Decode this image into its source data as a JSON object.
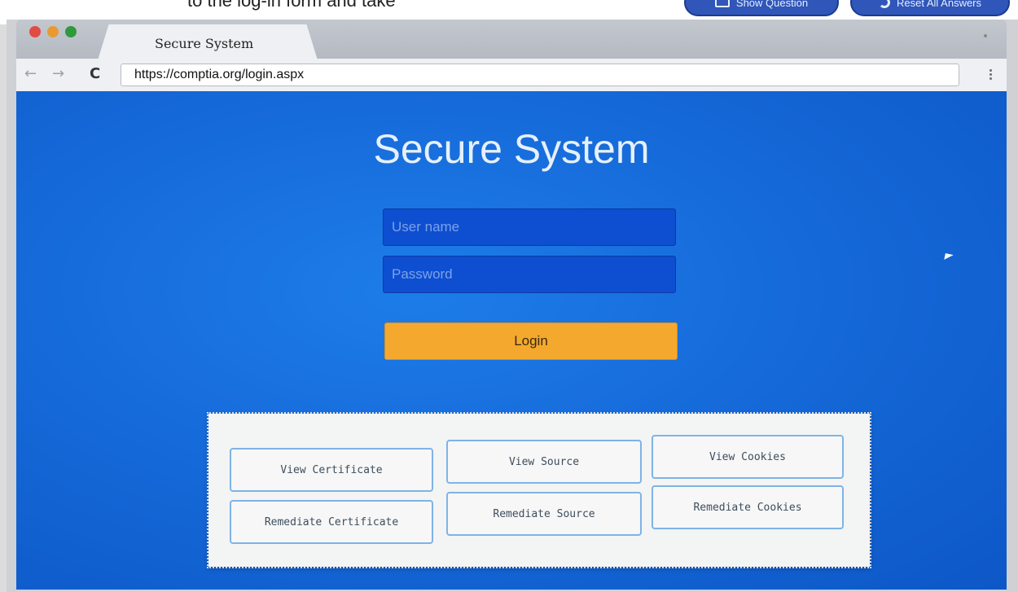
{
  "outer": {
    "clipped_text": "to the log-in form and take",
    "show_question_label": "Show Question",
    "reset_answers_label": "Reset All Answers"
  },
  "browser": {
    "tab_title": "Secure System",
    "url": "https://comptia.org/login.aspx"
  },
  "page": {
    "title": "Secure System",
    "username_placeholder": "User name",
    "password_placeholder": "Password",
    "login_label": "Login"
  },
  "options": [
    {
      "label": "View Certificate"
    },
    {
      "label": "View Source"
    },
    {
      "label": "View Cookies"
    },
    {
      "label": "Remediate Certificate"
    },
    {
      "label": "Remediate Source"
    },
    {
      "label": "Remediate Cookies"
    }
  ],
  "colors": {
    "page_background": "#166ad9",
    "login_button": "#f4a82e",
    "option_border": "#7fb3e6"
  },
  "icons": {
    "show_question": "keyboard-icon",
    "reset_answers": "reset-icon"
  }
}
